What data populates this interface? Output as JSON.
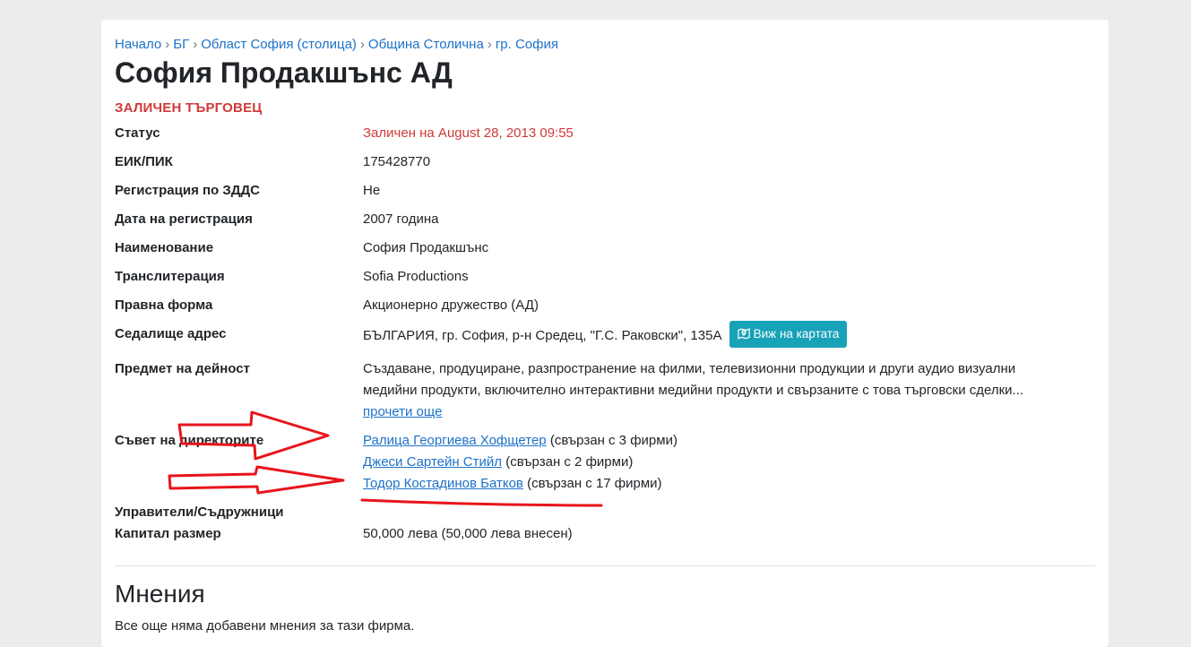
{
  "breadcrumb": [
    {
      "label": "Начало"
    },
    {
      "label": "БГ"
    },
    {
      "label": "Област София (столица)"
    },
    {
      "label": "Община Столична"
    },
    {
      "label": "гр. София"
    }
  ],
  "breadcrumb_separator": "›",
  "company": {
    "title": "София Продакшънс АД",
    "deleted_flag": "ЗАЛИЧЕН ТЪРГОВЕЦ"
  },
  "details": {
    "status": {
      "label": "Статус",
      "value": "Заличен на August 28, 2013 09:55"
    },
    "eik": {
      "label": "ЕИК/ПИК",
      "value": "175428770"
    },
    "vat": {
      "label": "Регистрация по ЗДДС",
      "value": "Не"
    },
    "reg_date": {
      "label": "Дата на регистрация",
      "value": "2007 година"
    },
    "name": {
      "label": "Наименование",
      "value": "София Продакшънс"
    },
    "translit": {
      "label": "Транслитерация",
      "value": "Sofia Productions"
    },
    "legal_form": {
      "label": "Правна форма",
      "value": "Акционерно дружество (АД)"
    },
    "address": {
      "label": "Седалище адрес",
      "value": "БЪЛГАРИЯ, гр. София, р-н Средец, \"Г.С. Раковски\", 135А",
      "map_button": "Виж на картата"
    },
    "activity": {
      "label": "Предмет на дейност",
      "line1": "Създаване, продуциране, разпространение на филми, телевизионни продукции и други аудио визуални",
      "line2": "медийни продукти, включително интерактивни медийни продукти и свързаните с това търговски сделки...",
      "read_more": "прочети още"
    },
    "board": {
      "label": "Съвет на директорите",
      "members": [
        {
          "name": "Ралица Георгиева Хофщетер",
          "note": "(свързан с 3 фирми)"
        },
        {
          "name": "Джеси Сартейн Стийл",
          "note": "(свързан с 2 фирми)"
        },
        {
          "name": "Тодор Костадинов Батков",
          "note": "(свързан с 17 фирми)"
        }
      ]
    },
    "managers": {
      "label": "Управители/Съдружници",
      "value": ""
    },
    "capital": {
      "label": "Капитал размер",
      "value": "50,000 лева (50,000 лева внесен)"
    }
  },
  "reviews": {
    "title": "Мнения",
    "empty_text": "Все още няма добавени мнения за тази фирма."
  },
  "colors": {
    "link": "#1d72c8",
    "danger": "#d03a3a",
    "info_button": "#17a2b8",
    "annotation": "#e8141c"
  },
  "icons": {
    "map_button_icon": "map-marker-icon"
  }
}
